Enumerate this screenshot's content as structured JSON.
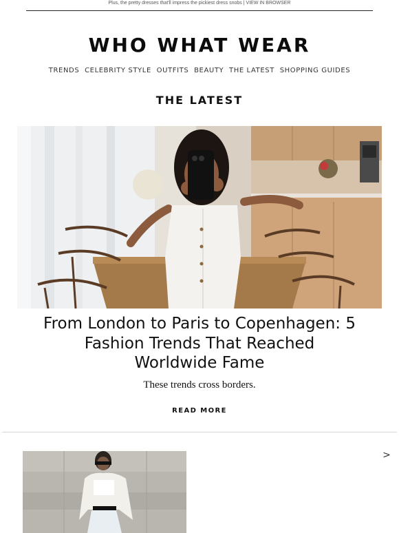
{
  "preheader": {
    "text": "Plus, the pretty dresses that'll impress the pickiest dress snobs",
    "separator": " | ",
    "view_in_browser": "VIEW IN BROWSER"
  },
  "brand": {
    "logo": "WHO WHAT WEAR"
  },
  "nav": {
    "items": [
      {
        "label": "TRENDS"
      },
      {
        "label": "CELEBRITY STYLE"
      },
      {
        "label": "OUTFITS"
      },
      {
        "label": "BEAUTY"
      },
      {
        "label": "THE LATEST"
      },
      {
        "label": "SHOPPING GUIDES"
      }
    ]
  },
  "section": {
    "title": "THE LATEST"
  },
  "featured": {
    "image_alt": "Woman in white sleeveless button-front dress taking a mirror selfie in a kitchen with a wooden table and chairs",
    "headline": "From London to Paris to Copenhagen: 5 Fashion Trends That Reached Worldwide Fame",
    "dek": "These trends cross borders.",
    "cta": "READ MORE"
  },
  "next_card": {
    "image_alt": "Woman in sunglasses, white crop top and white skirt against a stone wall",
    "arrow": ">"
  },
  "colors": {
    "text": "#111111",
    "divider": "#d8d8d8",
    "background": "#ffffff"
  }
}
